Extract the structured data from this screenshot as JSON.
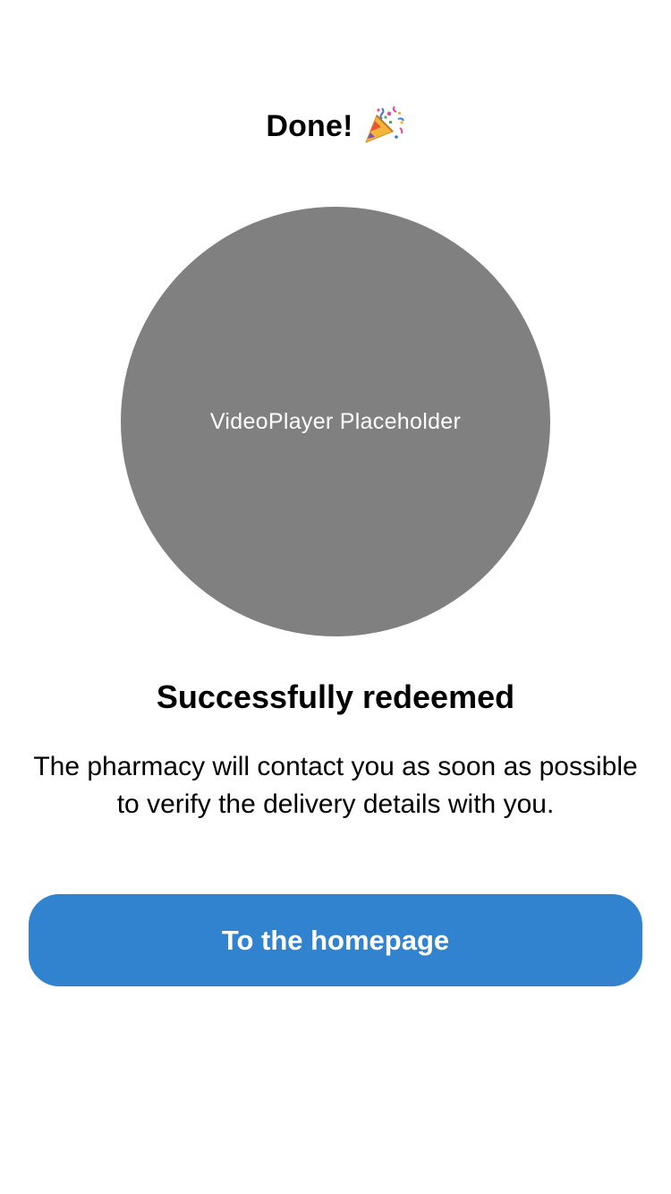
{
  "header": {
    "title": "Done!",
    "icon": "party-popper-icon"
  },
  "video": {
    "placeholder_label": "VideoPlayer Placeholder"
  },
  "content": {
    "heading": "Successfully redeemed",
    "message": "The pharmacy will contact you as soon as possible to verify the delivery details with you."
  },
  "actions": {
    "home_button_label": "To the homepage"
  },
  "colors": {
    "primary_button": "#3183cf",
    "placeholder_gray": "#808080",
    "background": "#ffffff"
  }
}
